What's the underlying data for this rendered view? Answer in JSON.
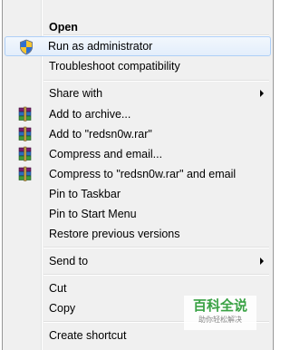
{
  "menu": {
    "items": [
      {
        "label": "Open",
        "bold": true,
        "icon": "",
        "submenu": false
      },
      {
        "label": "Run as administrator",
        "bold": false,
        "icon": "uac-shield-icon",
        "submenu": false,
        "highlighted": true
      },
      {
        "label": "Troubleshoot compatibility",
        "bold": false,
        "icon": "",
        "submenu": false
      },
      {
        "label": "Share with",
        "bold": false,
        "icon": "",
        "submenu": true
      },
      {
        "label": "Add to archive...",
        "bold": false,
        "icon": "winrar-icon",
        "submenu": false
      },
      {
        "label": "Add to \"redsn0w.rar\"",
        "bold": false,
        "icon": "winrar-icon",
        "submenu": false
      },
      {
        "label": "Compress and email...",
        "bold": false,
        "icon": "winrar-icon",
        "submenu": false
      },
      {
        "label": "Compress to \"redsn0w.rar\" and email",
        "bold": false,
        "icon": "winrar-icon",
        "submenu": false
      },
      {
        "label": "Pin to Taskbar",
        "bold": false,
        "icon": "",
        "submenu": false
      },
      {
        "label": "Pin to Start Menu",
        "bold": false,
        "icon": "",
        "submenu": false
      },
      {
        "label": "Restore previous versions",
        "bold": false,
        "icon": "",
        "submenu": false
      },
      {
        "label": "Send to",
        "bold": false,
        "icon": "",
        "submenu": true
      },
      {
        "label": "Cut",
        "bold": false,
        "icon": "",
        "submenu": false
      },
      {
        "label": "Copy",
        "bold": false,
        "icon": "",
        "submenu": false
      },
      {
        "label": "Create shortcut",
        "bold": false,
        "icon": "",
        "submenu": false
      }
    ]
  },
  "watermark": {
    "title": "百科全说",
    "subtitle": "助你轻松解决"
  },
  "colors": {
    "menu_background": "#f0f0f0",
    "highlight_border": "#aecff7",
    "watermark_green": "#3aa245"
  }
}
